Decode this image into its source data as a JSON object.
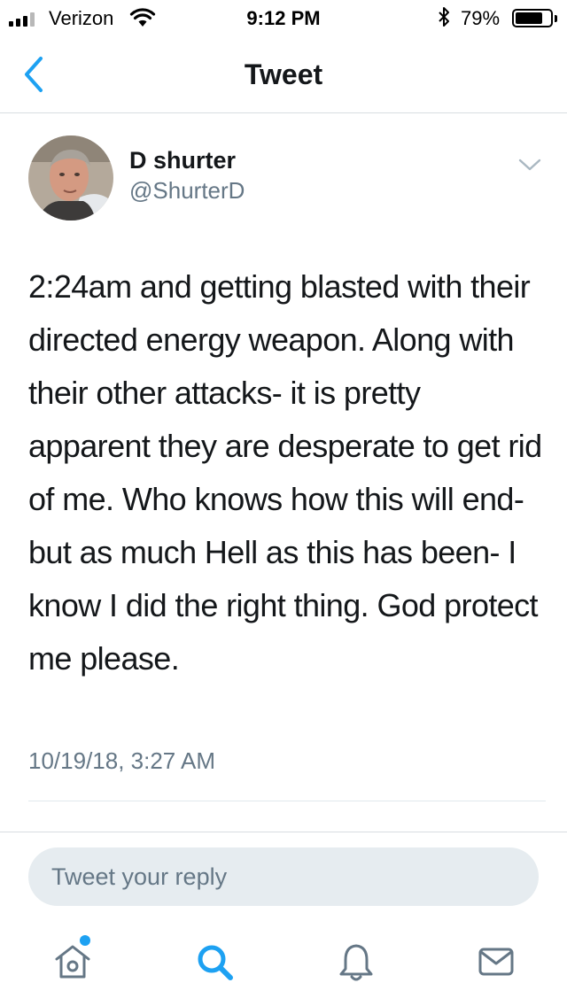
{
  "status_bar": {
    "carrier": "Verizon",
    "time": "9:12 PM",
    "battery_percent": "79%",
    "battery_level": 0.79,
    "signal_bars": 3,
    "signal_bars_total": 4
  },
  "nav": {
    "title": "Tweet",
    "back_icon": "chevron-left-icon"
  },
  "tweet": {
    "author_name": "D shurter",
    "author_handle": "@ShurterD",
    "text": "2:24am and getting blasted with their directed energy weapon. Along with their other attacks- it is pretty apparent they are desperate to get rid of me. Who knows how this will end- but as much Hell as this has been- I know I did the right thing. God protect me please.",
    "timestamp": "10/19/18, 3:27 AM"
  },
  "reply": {
    "placeholder": "Tweet your reply"
  },
  "tab_bar": {
    "items": [
      {
        "name": "home",
        "icon": "home-icon",
        "active": false,
        "has_notification_dot": true
      },
      {
        "name": "search",
        "icon": "search-icon",
        "active": true
      },
      {
        "name": "notifications",
        "icon": "bell-icon",
        "active": false
      },
      {
        "name": "messages",
        "icon": "envelope-icon",
        "active": false
      }
    ]
  },
  "colors": {
    "accent": "#1da1f2",
    "text_primary": "#14171a",
    "text_secondary": "#657786",
    "reply_background": "#e6ecf0",
    "divider": "#e1e8ed"
  }
}
